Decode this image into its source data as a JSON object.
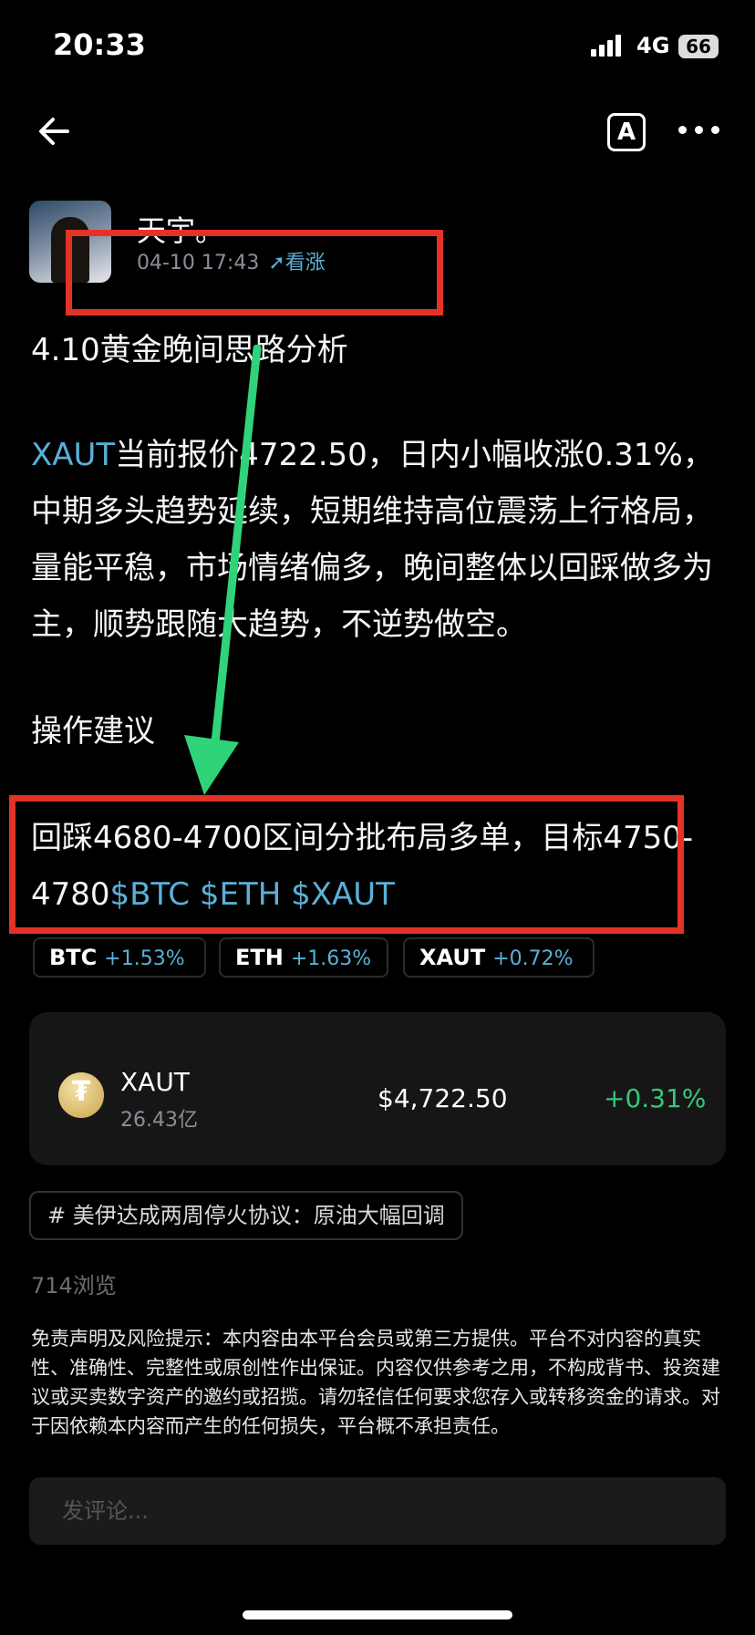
{
  "status_bar": {
    "time": "20:33",
    "network": "4G",
    "battery": "66"
  },
  "post": {
    "author": "天宇。",
    "date": "04-10 17:43",
    "trend": "看涨",
    "title": "4.10黄金晚间思路分析",
    "body_tag": "XAUT",
    "body_text": "当前报价4722.50，日内小幅收涨0.31%，中期多头趋势延续，短期维持高位震荡上行格局，量能平稳，市场情绪偏多，晚间整体以回踩做多为主，顺势跟随大趋势，不逆势做空。",
    "ops_label": "操作建议",
    "plan_text": "回踩4680-4700区间分批布局多单，目标4750-4780",
    "plan_tags": "$BTC $ETH $XAUT"
  },
  "tickers": [
    {
      "symbol": "BTC",
      "change": "+1.53%"
    },
    {
      "symbol": "ETH",
      "change": "+1.63%"
    },
    {
      "symbol": "XAUT",
      "change": "+0.72%"
    }
  ],
  "quote_card": {
    "name": "XAUT",
    "volume": "26.43亿",
    "price": "$4,722.50",
    "change": "+0.31%"
  },
  "topic": "#  美伊达成两周停火协议：原油大幅回调",
  "views": "714浏览",
  "disclaimer": "免责声明及风险提示：本内容由本平台会员或第三方提供。平台不对内容的真实性、准确性、完整性或原创性作出保证。内容仅供参考之用，不构成背书、投资建议或买卖数字资产的邀约或招揽。请勿轻信任何要求您存入或转移资金的请求。对于因依赖本内容而产生的任何损失，平台概不承担责任。",
  "comment_placeholder": "发评论...",
  "colors": {
    "accent": "#5bb0d8",
    "positive": "#37c77a",
    "annotation_red": "#e53226",
    "annotation_arrow": "#2fd37a"
  }
}
